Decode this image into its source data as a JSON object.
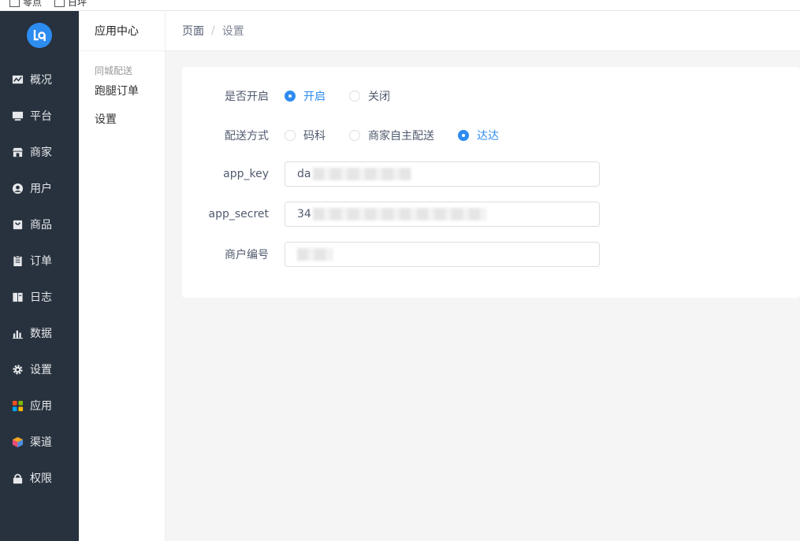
{
  "topbar": {
    "checkboxes": [
      "零点",
      "日坪"
    ]
  },
  "sidebar": {
    "items": [
      {
        "label": "概况",
        "icon": "chart-icon"
      },
      {
        "label": "平台",
        "icon": "monitor-icon"
      },
      {
        "label": "商家",
        "icon": "store-icon"
      },
      {
        "label": "用户",
        "icon": "user-icon"
      },
      {
        "label": "商品",
        "icon": "bag-icon"
      },
      {
        "label": "订单",
        "icon": "clipboard-icon"
      },
      {
        "label": "日志",
        "icon": "book-icon"
      },
      {
        "label": "数据",
        "icon": "bar-chart-icon"
      },
      {
        "label": "设置",
        "icon": "gear-icon"
      },
      {
        "label": "应用",
        "icon": "apps-icon"
      },
      {
        "label": "渠道",
        "icon": "cube-icon"
      },
      {
        "label": "权限",
        "icon": "lock-icon"
      }
    ]
  },
  "subnav": {
    "header": "应用中心",
    "group": "同城配送",
    "items": [
      "跑腿订单",
      "设置"
    ]
  },
  "breadcrumb": {
    "first": "页面",
    "separator": "/",
    "second": "设置"
  },
  "form": {
    "enable": {
      "label": "是否开启",
      "options": [
        "开启",
        "关闭"
      ],
      "selected": "开启"
    },
    "method": {
      "label": "配送方式",
      "options": [
        "码科",
        "商家自主配送",
        "达达"
      ],
      "selected": "达达"
    },
    "app_key": {
      "label": "app_key",
      "value_prefix": "da"
    },
    "app_secret": {
      "label": "app_secret",
      "value_prefix": "34"
    },
    "merchant_no": {
      "label": "商户编号",
      "value_prefix": ""
    }
  },
  "colors": {
    "sidebar_bg": "#28323e",
    "accent": "#2d8cf0",
    "page_bg": "#f5f5f5"
  }
}
